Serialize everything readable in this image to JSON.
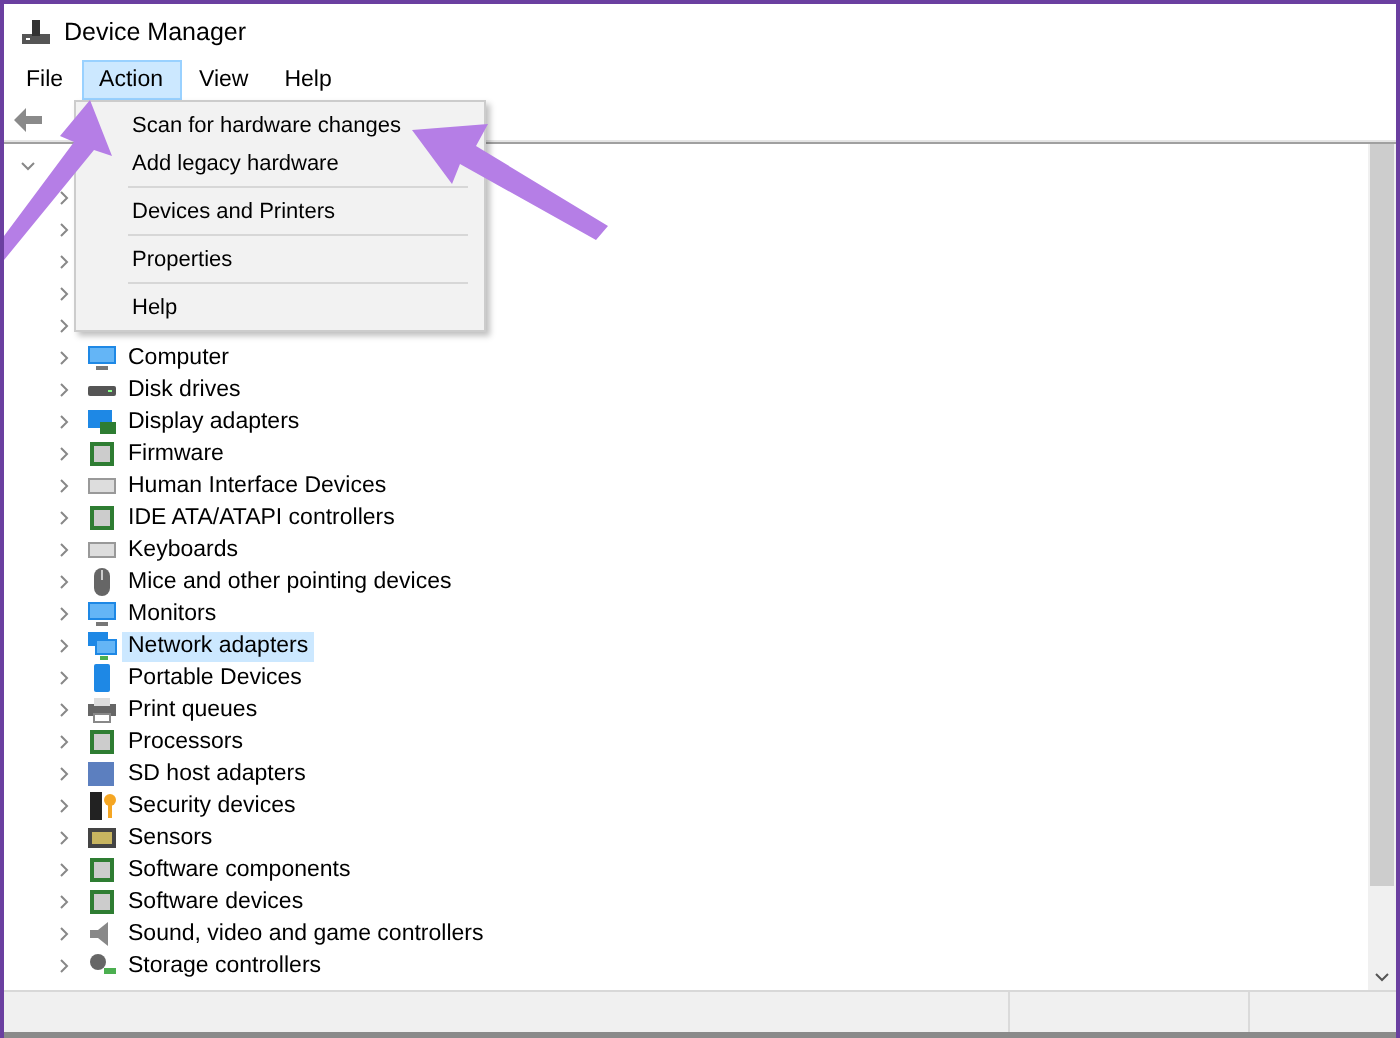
{
  "window": {
    "title": "Device Manager"
  },
  "menu_bar": [
    {
      "label": "File",
      "selected": false
    },
    {
      "label": "Action",
      "selected": true
    },
    {
      "label": "View",
      "selected": false
    },
    {
      "label": "Help",
      "selected": false
    }
  ],
  "action_menu": [
    {
      "kind": "item",
      "label": "Scan for hardware changes"
    },
    {
      "kind": "item",
      "label": "Add legacy hardware"
    },
    {
      "kind": "separator"
    },
    {
      "kind": "item",
      "label": "Devices and Printers"
    },
    {
      "kind": "separator"
    },
    {
      "kind": "item",
      "label": "Properties"
    },
    {
      "kind": "separator"
    },
    {
      "kind": "item",
      "label": "Help"
    }
  ],
  "tree": {
    "root": {
      "expanded": true
    },
    "children": [
      {
        "kind": "covered"
      },
      {
        "kind": "covered"
      },
      {
        "kind": "covered"
      },
      {
        "kind": "covered"
      },
      {
        "kind": "covered"
      },
      {
        "kind": "device",
        "label": "Computer",
        "selected": false
      },
      {
        "kind": "device",
        "label": "Disk drives",
        "selected": false
      },
      {
        "kind": "device",
        "label": "Display adapters",
        "selected": false
      },
      {
        "kind": "device",
        "label": "Firmware",
        "selected": false
      },
      {
        "kind": "device",
        "label": "Human Interface Devices",
        "selected": false
      },
      {
        "kind": "device",
        "label": "IDE ATA/ATAPI controllers",
        "selected": false
      },
      {
        "kind": "device",
        "label": "Keyboards",
        "selected": false
      },
      {
        "kind": "device",
        "label": "Mice and other pointing devices",
        "selected": false
      },
      {
        "kind": "device",
        "label": "Monitors",
        "selected": false
      },
      {
        "kind": "device",
        "label": "Network adapters",
        "selected": true
      },
      {
        "kind": "device",
        "label": "Portable Devices",
        "selected": false
      },
      {
        "kind": "device",
        "label": "Print queues",
        "selected": false
      },
      {
        "kind": "device",
        "label": "Processors",
        "selected": false
      },
      {
        "kind": "device",
        "label": "SD host adapters",
        "selected": false
      },
      {
        "kind": "device",
        "label": "Security devices",
        "selected": false
      },
      {
        "kind": "device",
        "label": "Sensors",
        "selected": false
      },
      {
        "kind": "device",
        "label": "Software components",
        "selected": false
      },
      {
        "kind": "device",
        "label": "Software devices",
        "selected": false
      },
      {
        "kind": "device",
        "label": "Sound, video and game controllers",
        "selected": false
      },
      {
        "kind": "device",
        "label": "Storage controllers",
        "selected": false
      }
    ]
  }
}
